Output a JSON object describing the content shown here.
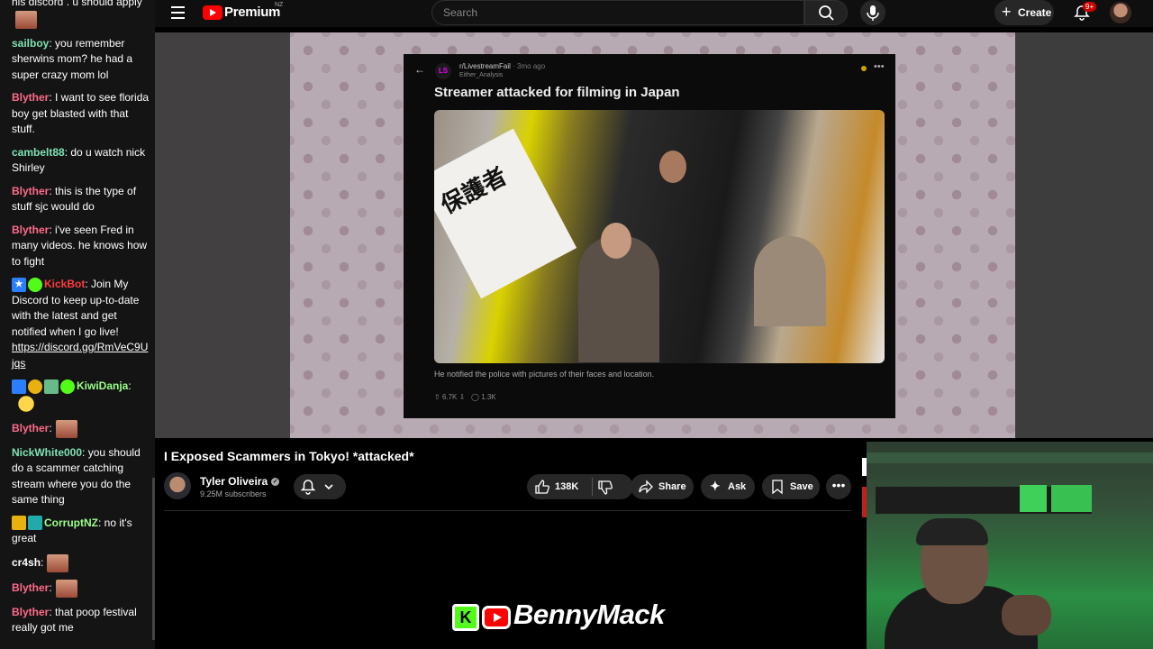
{
  "chat": {
    "messages": [
      {
        "user": "",
        "text": "his discord . u should apply",
        "color": "#ffffff"
      },
      {
        "user": "sailboy",
        "text": ": you remember sherwins mom? he had a super crazy mom lol",
        "color": "#7fe3b4"
      },
      {
        "user": "Blyther",
        "text": ": I want to see florida boy get blasted with that stuff.",
        "color": "#ff6b8a"
      },
      {
        "user": "cambelt88",
        "text": ": do u watch nick Shirley",
        "color": "#7fe3b4"
      },
      {
        "user": "Blyther",
        "text": ": this is the type of stuff sjc would do",
        "color": "#ff6b8a"
      },
      {
        "user": "Blyther",
        "text": ": i've seen Fred in many videos. he knows how to fight",
        "color": "#ff6b8a"
      },
      {
        "user": "KickBot",
        "text": ": Join My Discord to keep up-to-date with the latest and get notified when I go live! ",
        "link": "https://discord.gg/RmVeC9Ujqs",
        "color": "#ff3b3b"
      },
      {
        "user": "KiwiDanja",
        "text": ":",
        "color": "#9bff8a"
      },
      {
        "user": "Blyther",
        "text": ":",
        "color": "#ff6b8a"
      },
      {
        "user": "NickWhite000",
        "text": ": you should do a scammer catching stream where you do the same thing",
        "color": "#7fe3b4"
      },
      {
        "user": "CorruptNZ",
        "text": ": no it's great",
        "color": "#9bff8a"
      },
      {
        "user": "cr4sh",
        "text": ":",
        "color": "#ffffff"
      },
      {
        "user": "Blyther",
        "text": ":",
        "color": "#ff6b8a"
      },
      {
        "user": "Blyther",
        "text": ": that poop festival really got me",
        "color": "#ff6b8a"
      }
    ]
  },
  "topbar": {
    "brand": "Premium",
    "region": "NZ",
    "search_placeholder": "Search",
    "create_label": "Create",
    "notification_count": "9+"
  },
  "post": {
    "logo": "LS",
    "subreddit": "r/LivestreamFail",
    "time": "· 3mo ago",
    "user": "Either_Analysis",
    "title": "Streamer attacked for filming in Japan",
    "sign_text": "保護者",
    "caption": "He notified the police with pictures of their faces and location.",
    "upvotes": "6.7K",
    "comments": "1.3K"
  },
  "video": {
    "title": "I Exposed Scammers in Tokyo! *attacked*",
    "channel": "Tyler Oliveira",
    "subscribers": "9.25M subscribers",
    "likes": "138K",
    "share_label": "Share",
    "ask_label": "Ask",
    "save_label": "Save"
  },
  "overlay": {
    "kick_letter": "K",
    "streamer_name": "BennyMack"
  }
}
